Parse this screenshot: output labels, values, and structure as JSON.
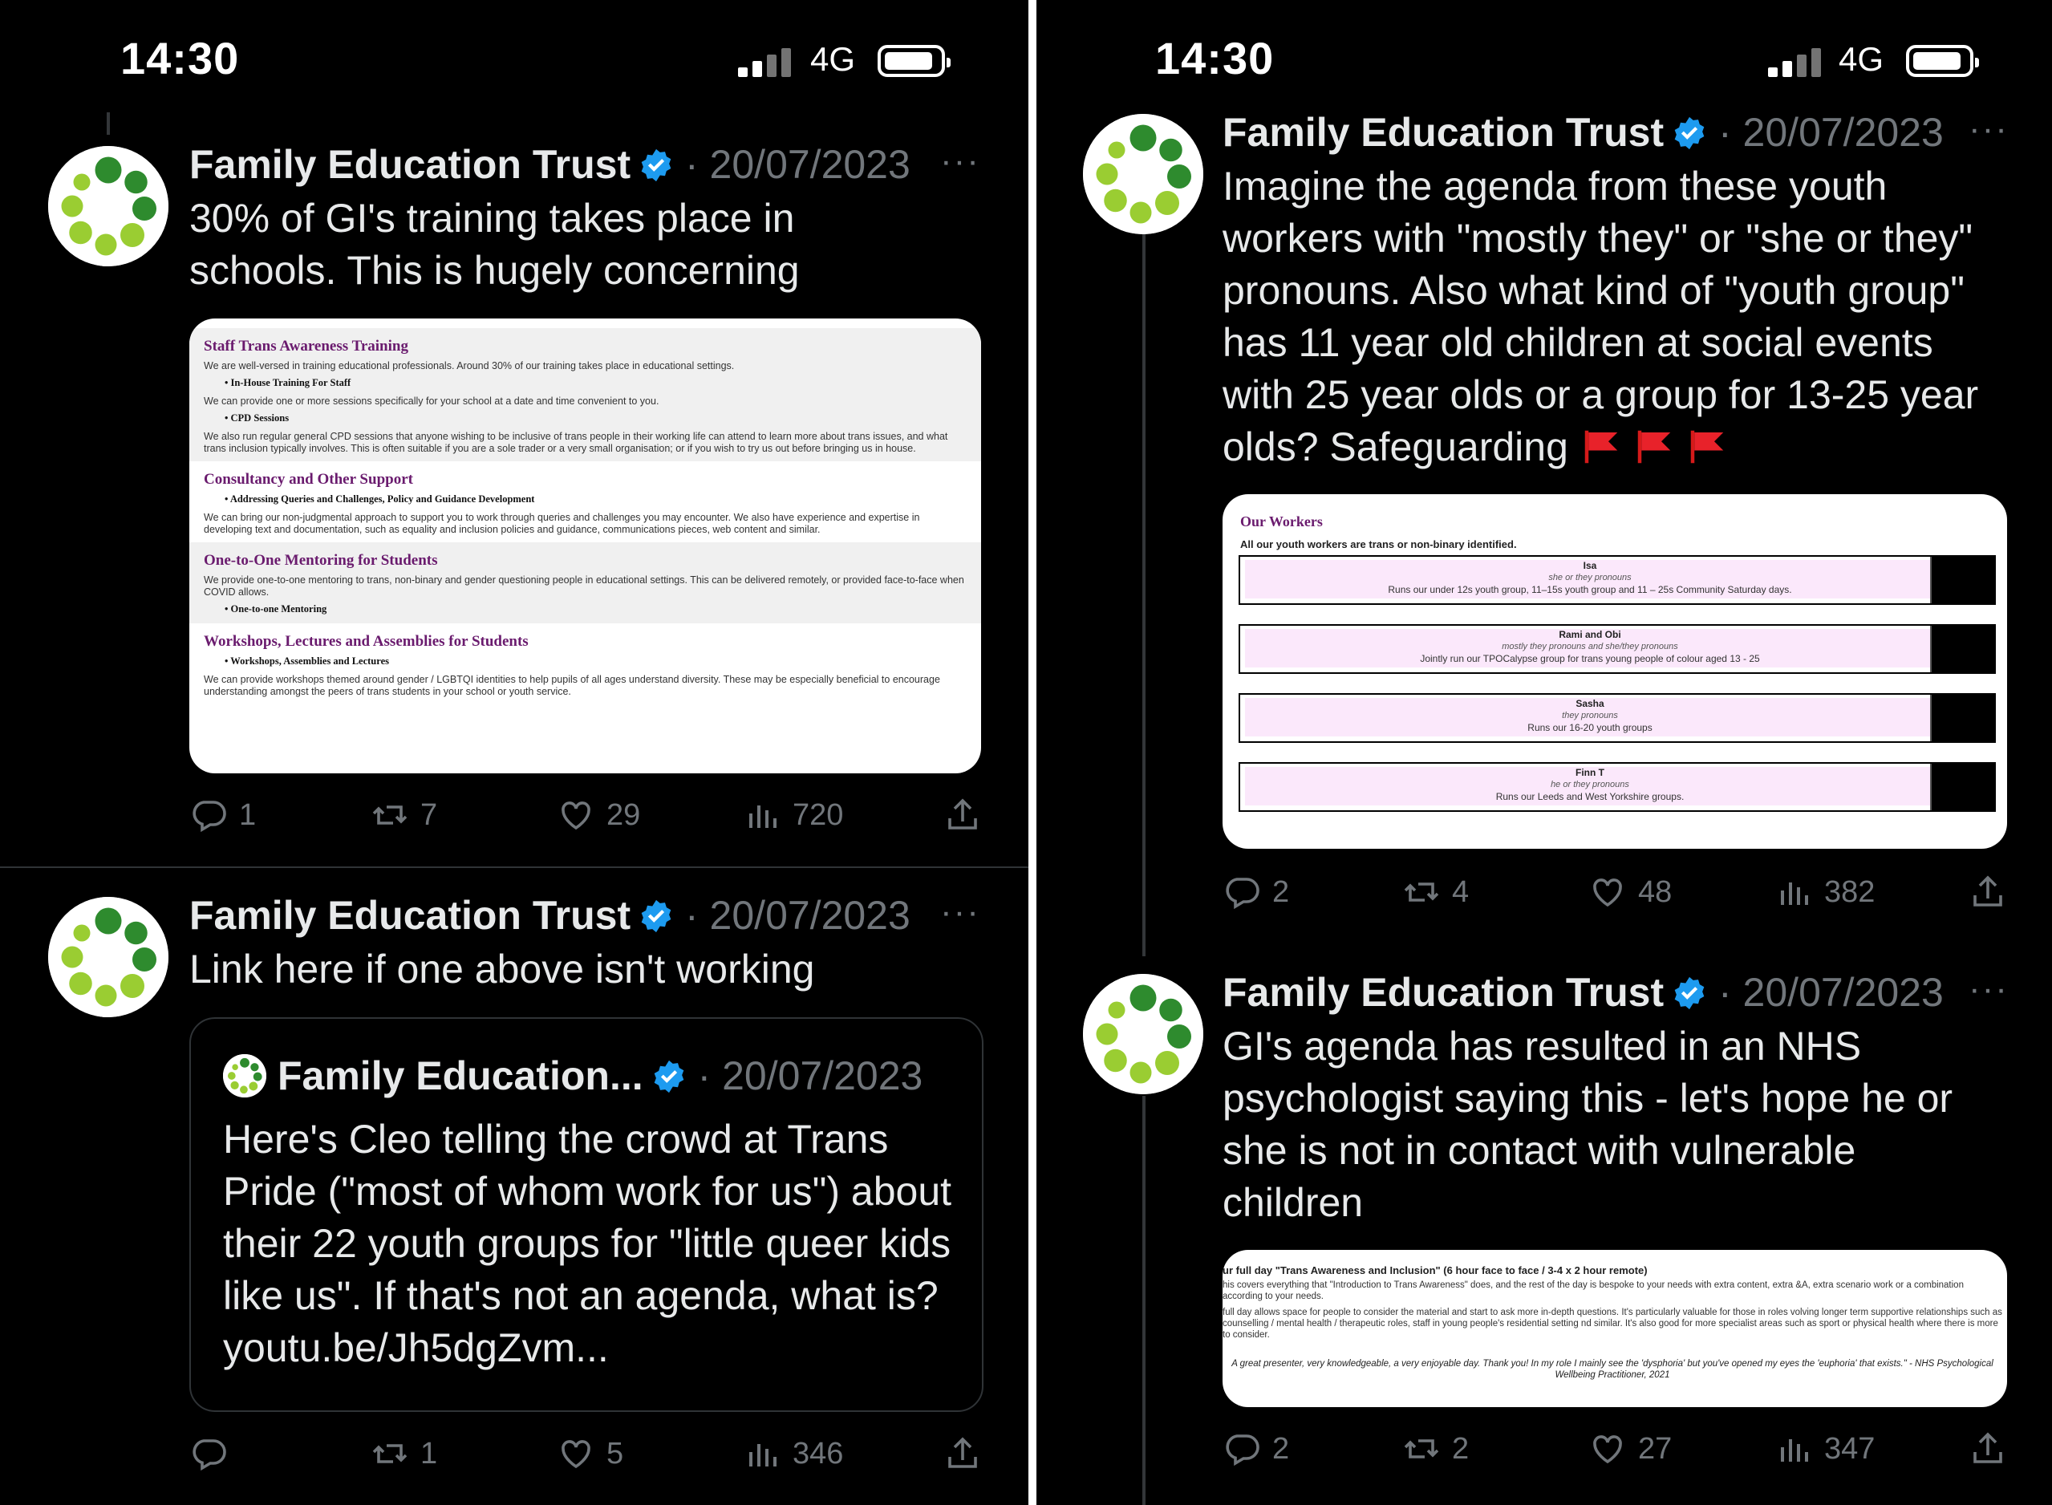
{
  "status": {
    "time": "14:30",
    "network": "4G"
  },
  "colors": {
    "verified": "#1d9bf0",
    "dim_text": "#71767b",
    "logo_dark": "#2e8b2e",
    "logo_light": "#9acd32"
  },
  "left": {
    "tweet1": {
      "name": "Family Education Trust",
      "date": "· 20/07/2023",
      "more": "···",
      "text": "30% of GI's training takes place in\nschools. This is hugely concerning",
      "media": {
        "sections": [
          {
            "title": "Staff Trans Awareness Training",
            "intro": "We are well-versed in training educational professionals. Around 30% of our training takes place in educational settings.",
            "items": [
              {
                "label": "In-House Training For Staff",
                "text": "We can provide one or more sessions specifically for your school at a date and time convenient to you."
              },
              {
                "label": "CPD Sessions",
                "text": "We also run regular general CPD sessions that anyone wishing to be inclusive of trans people in their working life can attend to learn more about trans issues, and what trans inclusion typically involves. This is often suitable if you are a sole trader or a very small organisation; or if you wish to try us out before bringing us in house."
              }
            ]
          },
          {
            "title": "Consultancy and Other Support",
            "intro": "",
            "items": [
              {
                "label": "Addressing Queries and Challenges, Policy and Guidance Development",
                "text": "We can bring our non-judgmental approach to support you to work through queries and challenges you may encounter. We also have experience and expertise in developing text and documentation, such as equality and inclusion policies and guidance, communications pieces, web content and similar."
              }
            ]
          },
          {
            "title": "One-to-One Mentoring for Students",
            "intro": "We provide one-to-one mentoring to trans, non-binary and gender questioning people in educational settings. This can be delivered remotely, or provided face-to-face when COVID allows.",
            "items": [
              {
                "label": "One-to-one Mentoring",
                "text": ""
              }
            ]
          },
          {
            "title": "Workshops, Lectures and Assemblies for Students",
            "intro": "",
            "items": [
              {
                "label": "Workshops, Assemblies and Lectures",
                "text": "We can provide workshops themed around gender / LGBTQI identities to help pupils of all ages understand diversity. These may be especially beneficial to encourage understanding amongst the peers of trans students in your school or youth service."
              }
            ]
          }
        ]
      },
      "counts": {
        "replies": "1",
        "retweets": "7",
        "likes": "29",
        "views": "720"
      }
    },
    "tweet2": {
      "name": "Family Education Trust",
      "date": "· 20/07/2023",
      "more": "···",
      "text": "Link here if one above isn't working",
      "quote": {
        "name": "Family Education...",
        "date": "· 20/07/2023",
        "text": "Here's Cleo telling the crowd at Trans Pride (\"most of whom work for us\") about their 22 youth groups for \"little queer kids like us\". If that's not an agenda, what is? youtu.be/Jh5dgZvm..."
      },
      "counts": {
        "replies": "",
        "retweets": "1",
        "likes": "5",
        "views": "346"
      }
    }
  },
  "right": {
    "tweet1": {
      "name": "Family Education Trust",
      "date": "· 20/07/2023",
      "more": "···",
      "text": "Imagine the agenda from these youth\nworkers with \"mostly they\" or \"she or they\"\npronouns. Also what kind of \"youth group\"\nhas 11 year old children at social events\nwith 25 year olds or a group for 13-25 year\nolds? Safeguarding",
      "media": {
        "title": "Our Workers",
        "subtitle": "All our youth workers are trans or non-binary identified.",
        "workers": [
          {
            "name": "Isa",
            "pronouns": "she or they pronouns",
            "role": "Runs our under 12s youth group, 11–15s youth group and 11 – 25s Community Saturday days."
          },
          {
            "name": "Rami and Obi",
            "pronouns": "mostly they pronouns and she/they pronouns",
            "role": "Jointly run our TPOCalypse group for trans young people of colour aged 13 - 25"
          },
          {
            "name": "Sasha",
            "pronouns": "they pronouns",
            "role": "Runs our 16-20 youth groups"
          },
          {
            "name": "Finn T",
            "pronouns": "he or they pronouns",
            "role": "Runs our Leeds and West Yorkshire groups."
          }
        ]
      },
      "counts": {
        "replies": "2",
        "retweets": "4",
        "likes": "48",
        "views": "382"
      }
    },
    "tweet2": {
      "name": "Family Education Trust",
      "date": "· 20/07/2023",
      "more": "···",
      "text": "GI's agenda has resulted in an NHS\npsychologist saying this - let's hope he or\nshe is not in contact with vulnerable\nchildren",
      "media": {
        "heading": "ur full day \"Trans Awareness and Inclusion\" (6 hour face to face / 3-4 x 2 hour remote)",
        "p1": "his covers everything that \"Introduction to Trans Awareness\" does, and the rest of the day is bespoke to your needs with extra content, extra &A, extra scenario work or a combination according to your needs.",
        "p2": "full day allows space for people to consider the material and start to ask more in-depth questions. It's particularly valuable for those in roles volving longer term supportive relationships such as counselling / mental health / therapeutic roles, staff in young people's residential setting nd similar. It's also good for more specialist areas such as sport or physical health where there is more to consider.",
        "quote": "A great presenter, very knowledgeable, a very enjoyable day. Thank you! In my role I mainly see the 'dysphoria' but you've opened my eyes the 'euphoria' that exists.\" - NHS Psychological Wellbeing Practitioner, 2021"
      },
      "counts": {
        "replies": "2",
        "retweets": "2",
        "likes": "27",
        "views": "347"
      }
    }
  }
}
